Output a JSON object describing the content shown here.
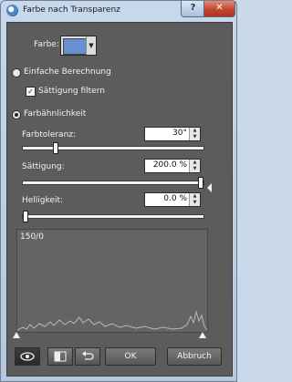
{
  "window": {
    "title": "Farbe nach Transparenz",
    "help_label": "?",
    "close_label": "✕"
  },
  "color": {
    "label": "Farbe:",
    "swatch_hex": "#6a8fd0"
  },
  "mode_simple": {
    "label": "Einfache Berechnung",
    "selected": false
  },
  "saturation_filter": {
    "label": "Sättigung filtern",
    "checked": true
  },
  "mode_similarity": {
    "label": "Farbähnlichkeit",
    "selected": true
  },
  "tolerance": {
    "label": "Farbtoleranz:",
    "value": "30°",
    "slider_fraction": 0.17
  },
  "saturation": {
    "label": "Sättigung:",
    "value": "200.0 %",
    "slider_fraction": 1.0
  },
  "brightness": {
    "label": "Helligkeit:",
    "value": "0.0 %",
    "slider_fraction": 0.0
  },
  "histogram": {
    "label": "150/0"
  },
  "footer": {
    "preview_icon": "eye-icon",
    "compare_icon": "split-view-icon",
    "reset_icon": "undo-arrow-icon",
    "ok_label": "OK",
    "cancel_label": "Abbruch"
  }
}
